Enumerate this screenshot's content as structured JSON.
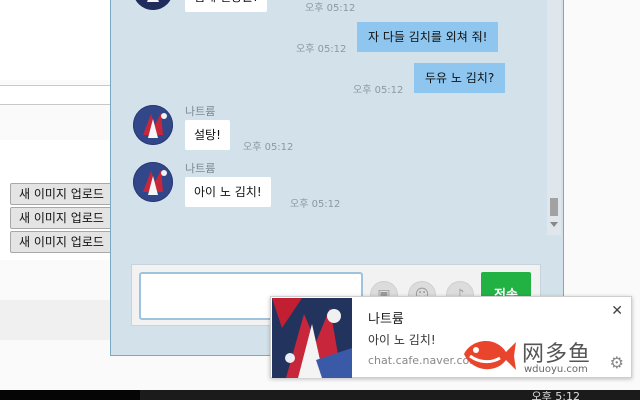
{
  "background": {
    "upload_buttons": [
      "새 이미지 업로드",
      "새 이미지 업로드",
      "새 이미지 업로드"
    ],
    "taskbar_time": "오후 5:12"
  },
  "chat": {
    "messages": [
      {
        "side": "left",
        "text": "쉽게 설탕을!",
        "time": "오후 05:12"
      },
      {
        "side": "right",
        "text": "자 다들 김치를 외쳐 줘!",
        "time": "오후 05:12"
      },
      {
        "side": "right",
        "text": "두유 노 김치?",
        "time": "오후 05:12"
      },
      {
        "side": "left",
        "sender": "나트륨",
        "text": "설탕!",
        "time": "오후 05:12"
      },
      {
        "side": "left",
        "sender": "나트륨",
        "text": "아이 노 김치!",
        "time": "오후 05:12"
      }
    ],
    "input": {
      "value": "",
      "placeholder": ""
    },
    "tools": [
      {
        "icon": "image-icon",
        "glyph": "▣"
      },
      {
        "icon": "emoticon-icon",
        "glyph": "☺"
      },
      {
        "icon": "sound-icon",
        "glyph": "♪"
      }
    ],
    "send_label": "전송"
  },
  "notification": {
    "title": "나트륨",
    "message": "아이 노 김치!",
    "source": "chat.cafe.naver.com",
    "close_glyph": "✕",
    "settings_glyph": "⚙"
  },
  "watermark": {
    "brand": "网多鱼",
    "url": "wduoyu.com"
  },
  "colors": {
    "chat_bg": "#d3e2ea",
    "my_bubble": "#8ec6ef",
    "send_button": "#22b244",
    "brand_red": "#e8452c"
  }
}
